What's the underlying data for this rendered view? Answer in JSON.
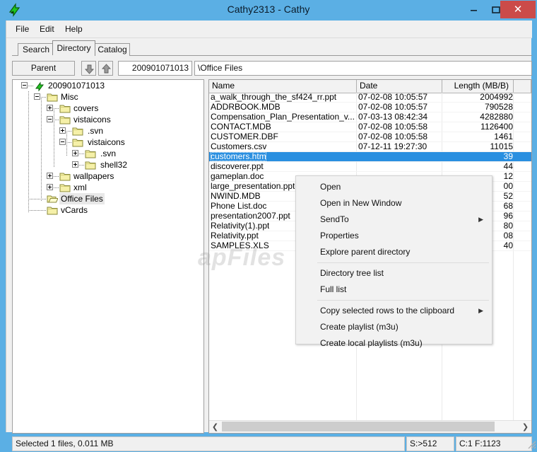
{
  "window": {
    "title": "Cathy2313 - Cathy",
    "app_icon": "cathy-green-arrow-icon",
    "minimize_label": "–",
    "maximize_label": "❑",
    "close_label": "✕",
    "titlebar_color": "#5bafe4",
    "close_color": "#cb4b49"
  },
  "menubar": {
    "items": [
      "File",
      "Edit",
      "Help"
    ]
  },
  "tabs": {
    "items": [
      "Search",
      "Directory",
      "Catalog"
    ],
    "active": "Directory"
  },
  "toolbar": {
    "parent_label": "Parent",
    "down_icon": "arrow-down-icon",
    "up_icon": "arrow-up-icon",
    "volume_value": "200901071013",
    "path_value": "\\Office Files"
  },
  "tree": {
    "nodes": [
      {
        "label": "200901071013",
        "depth": 0,
        "expander": "minus",
        "icon": "disk-icon",
        "selected": false
      },
      {
        "label": "Misc",
        "depth": 1,
        "expander": "minus",
        "icon": "folder-icon",
        "selected": false
      },
      {
        "label": "covers",
        "depth": 2,
        "expander": "plus",
        "icon": "folder-icon",
        "selected": false
      },
      {
        "label": "vistaicons",
        "depth": 2,
        "expander": "minus",
        "icon": "folder-icon",
        "selected": false
      },
      {
        "label": ".svn",
        "depth": 3,
        "expander": "plus",
        "icon": "folder-icon",
        "selected": false
      },
      {
        "label": "vistaicons",
        "depth": 3,
        "expander": "minus",
        "icon": "folder-icon",
        "selected": false
      },
      {
        "label": ".svn",
        "depth": 4,
        "expander": "plus",
        "icon": "folder-icon",
        "selected": false
      },
      {
        "label": "shell32",
        "depth": 4,
        "expander": "plus",
        "icon": "folder-icon",
        "selected": false
      },
      {
        "label": "wallpapers",
        "depth": 2,
        "expander": "plus",
        "icon": "folder-icon",
        "selected": false
      },
      {
        "label": "xml",
        "depth": 2,
        "expander": "plus",
        "icon": "folder-icon",
        "selected": false
      },
      {
        "label": "Office Files",
        "depth": 1,
        "expander": "none",
        "icon": "folder-open-icon",
        "selected": true
      },
      {
        "label": "vCards",
        "depth": 1,
        "expander": "none",
        "icon": "folder-icon",
        "selected": false
      }
    ]
  },
  "filelist": {
    "columns": [
      "Name",
      "Date",
      "Length (MB/B)",
      ""
    ],
    "rows": [
      {
        "name": "a_walk_through_the_sf424_rr.ppt",
        "date": "07-02-08 10:05:57",
        "length": "2004992",
        "selected": false
      },
      {
        "name": "ADDRBOOK.MDB",
        "date": "07-02-08 10:05:57",
        "length": "790528",
        "selected": false
      },
      {
        "name": "Compensation_Plan_Presentation_v...",
        "date": "07-03-13 08:42:34",
        "length": "4282880",
        "selected": false
      },
      {
        "name": "CONTACT.MDB",
        "date": "07-02-08 10:05:58",
        "length": "1126400",
        "selected": false
      },
      {
        "name": "CUSTOMER.DBF",
        "date": "07-02-08 10:05:58",
        "length": "1461",
        "selected": false
      },
      {
        "name": "Customers.csv",
        "date": "07-12-11 19:27:30",
        "length": "11015",
        "selected": false
      },
      {
        "name": "customers.htm",
        "date": "",
        "length": "39",
        "selected": true
      },
      {
        "name": "discoverer.ppt",
        "date": "",
        "length": "44",
        "selected": false
      },
      {
        "name": "gameplan.doc",
        "date": "",
        "length": "12",
        "selected": false
      },
      {
        "name": "large_presentation.ppt",
        "date": "",
        "length": "00",
        "selected": false
      },
      {
        "name": "NWIND.MDB",
        "date": "",
        "length": "52",
        "selected": false
      },
      {
        "name": "Phone List.doc",
        "date": "",
        "length": "68",
        "selected": false
      },
      {
        "name": "presentation2007.ppt",
        "date": "",
        "length": "96",
        "selected": false
      },
      {
        "name": "Relativity(1).ppt",
        "date": "",
        "length": "80",
        "selected": false
      },
      {
        "name": "Relativity.ppt",
        "date": "",
        "length": "08",
        "selected": false
      },
      {
        "name": "SAMPLES.XLS",
        "date": "",
        "length": "40",
        "selected": false
      }
    ],
    "scrollbar": {
      "left_icon": "chevron-left-icon",
      "right_icon": "chevron-right-icon"
    }
  },
  "context_menu": {
    "items": [
      {
        "label": "Open",
        "submenu": false
      },
      {
        "label": "Open in New Window",
        "submenu": false
      },
      {
        "label": "SendTo",
        "submenu": true
      },
      {
        "label": "Properties",
        "submenu": false
      },
      {
        "label": "Explore parent directory",
        "submenu": false
      },
      {
        "label": "Directory tree list",
        "submenu": false
      },
      {
        "label": "Full list",
        "submenu": false
      },
      {
        "label": "Copy selected rows to the clipboard",
        "submenu": true
      },
      {
        "label": "Create playlist (m3u)",
        "submenu": false
      },
      {
        "label": "Create local playlists (m3u)",
        "submenu": false
      }
    ],
    "submenu_arrow": "▶"
  },
  "statusbar": {
    "message": "Selected 1 files, 0.011 MB",
    "sectors": "S:>512",
    "counts": "C:1 F:1123",
    "grip": "resize-grip-icon"
  },
  "watermark": "apFiles"
}
